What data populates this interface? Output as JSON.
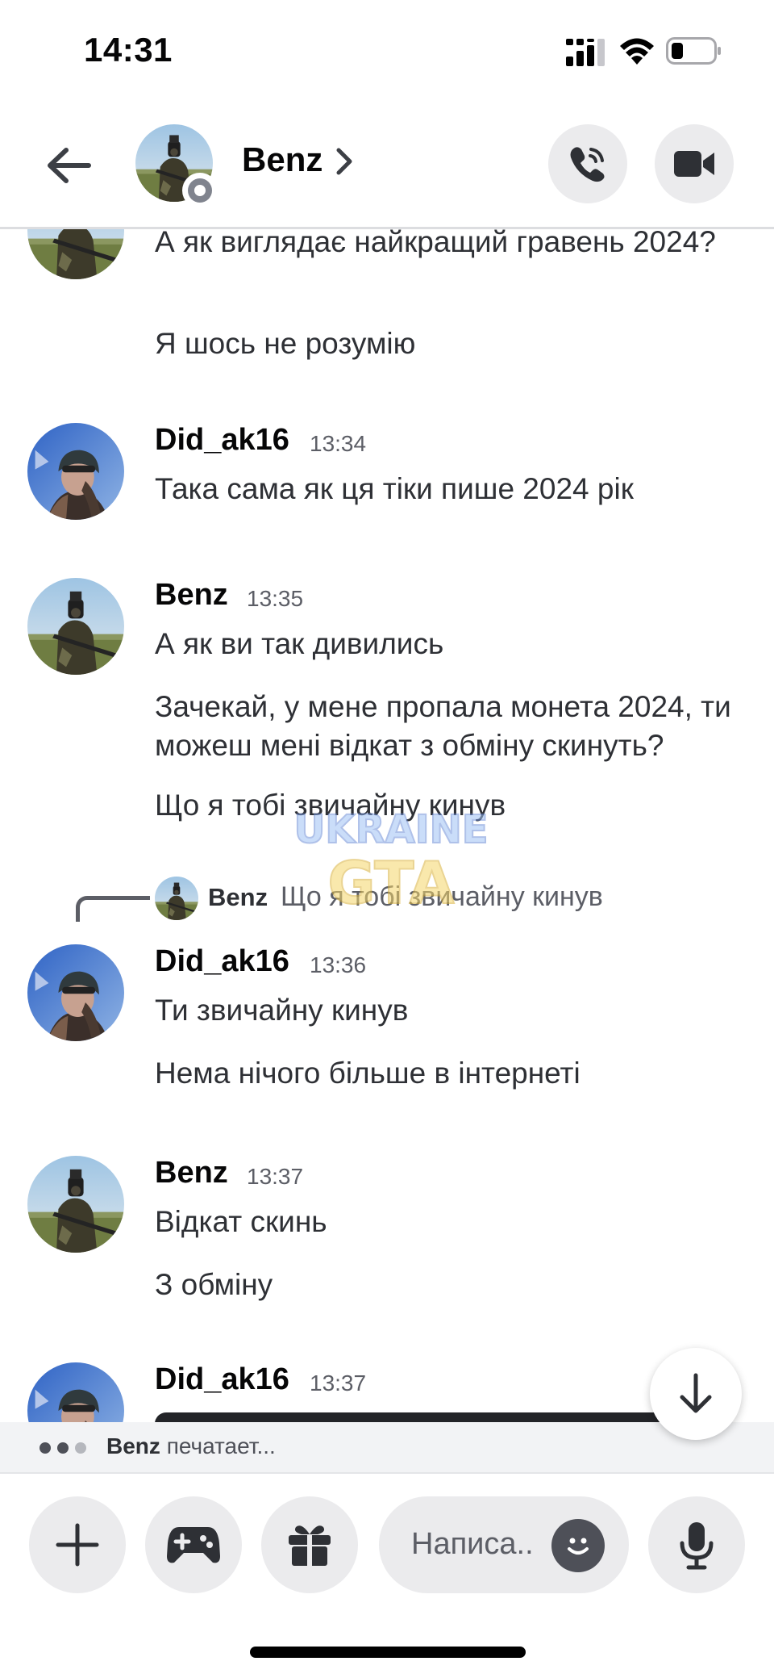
{
  "status_bar": {
    "time": "14:31",
    "icons": [
      "cellular-signal-icon",
      "wifi-icon",
      "battery-icon"
    ]
  },
  "header": {
    "back_icon": "arrow-left-icon",
    "name": "Benz",
    "chevron_icon": "chevron-right-icon",
    "presence": "offline",
    "call_icon": "phone-icon",
    "video_icon": "video-camera-icon"
  },
  "messages": [
    {
      "author": "",
      "time": "",
      "avatar": "soldier",
      "lines": [
        "А як виглядає найкращий гравень 2024?",
        "Я шось не розумію"
      ]
    },
    {
      "author": "Did_ak16",
      "time": "13:34",
      "avatar": "helmet",
      "lines": [
        "Така сама як ця тіки пише 2024 рік"
      ]
    },
    {
      "author": "Benz",
      "time": "13:35",
      "avatar": "soldier",
      "lines": [
        "А як ви так дивились",
        "Зачекай, у мене пропала монета 2024, ти можеш мені відкат з обміну скинуть?",
        "Що я тобі звичайну кинув"
      ]
    },
    {
      "author": "Did_ak16",
      "time": "13:36",
      "avatar": "helmet",
      "reply": {
        "author": "Benz",
        "text": "Що я тобі звичайну кинув"
      },
      "lines": [
        "Ти звичайну кинув",
        "Нема нічого більше в інтернеті"
      ]
    },
    {
      "author": "Benz",
      "time": "13:37",
      "avatar": "soldier",
      "lines": [
        "Відкат скинь",
        "З обміну"
      ]
    },
    {
      "author": "Did_ak16",
      "time": "13:37",
      "avatar": "helmet",
      "lines": []
    }
  ],
  "watermark": {
    "line1": "UKRAINE",
    "line2": "GTA"
  },
  "jump_icon": "arrow-down-icon",
  "typing": {
    "name": "Benz",
    "text": "печатает..."
  },
  "composer": {
    "placeholder": "Написа..",
    "icons": [
      "plus-icon",
      "gamepad-icon",
      "gift-icon",
      "emoji-icon",
      "microphone-icon"
    ]
  },
  "colors": {
    "text": "#060607",
    "muted": "#5c5e66",
    "button_bg": "#ebebed",
    "presence_offline": "#80848e"
  }
}
